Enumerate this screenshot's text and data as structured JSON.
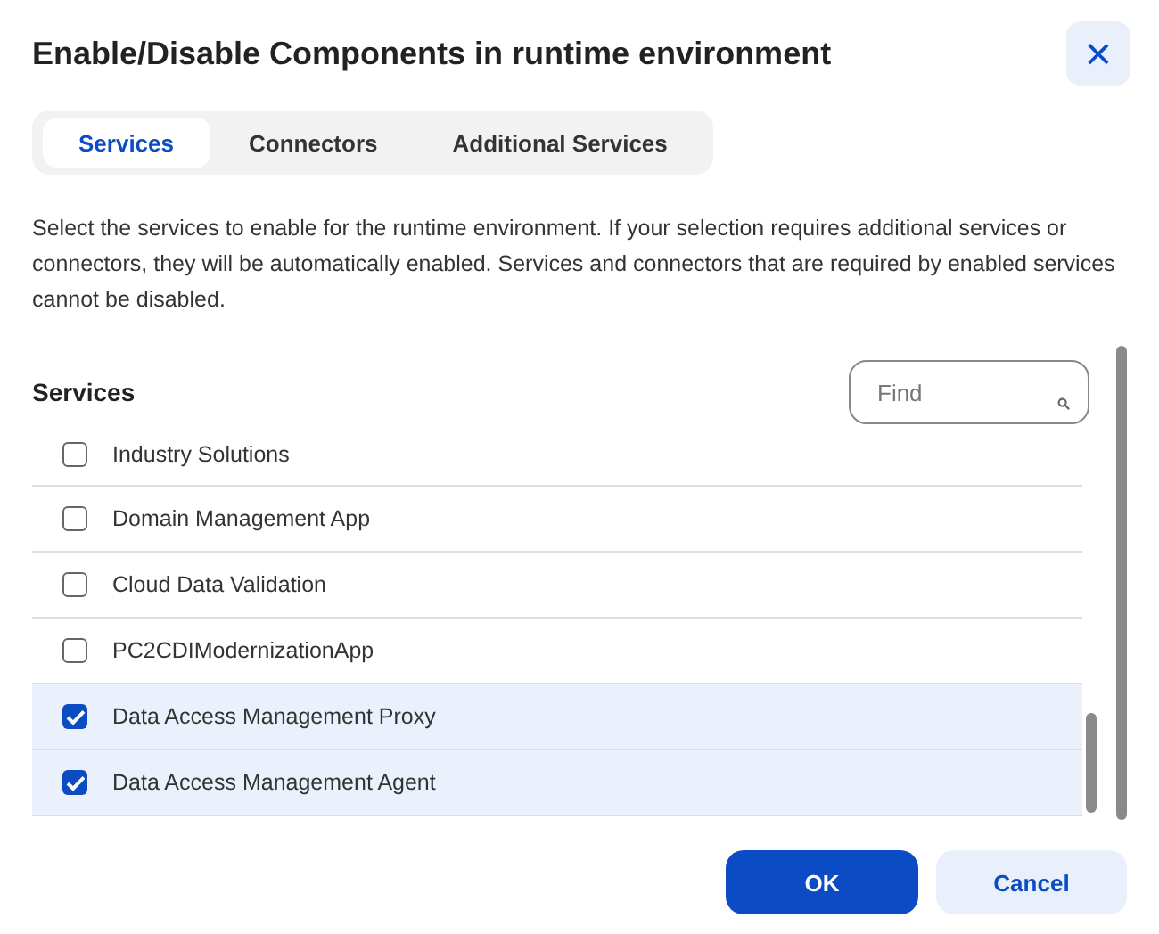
{
  "dialog": {
    "title": "Enable/Disable Components in runtime environment",
    "close_icon": "×"
  },
  "tabs": [
    {
      "label": "Services",
      "selected": true
    },
    {
      "label": "Connectors",
      "selected": false
    },
    {
      "label": "Additional Services",
      "selected": false
    }
  ],
  "description": "Select the services to enable for the runtime environment. If your selection requires additional services or connectors, they will be automatically enabled. Services and connectors that are required by enabled services cannot be disabled.",
  "section": {
    "title": "Services",
    "search": {
      "placeholder": "Find"
    }
  },
  "services": [
    {
      "name": "Industry Solutions",
      "checked": false
    },
    {
      "name": "Domain Management App",
      "checked": false
    },
    {
      "name": "Cloud Data Validation",
      "checked": false
    },
    {
      "name": "PC2CDIModernizationApp",
      "checked": false
    },
    {
      "name": "Data Access Management Proxy",
      "checked": true
    },
    {
      "name": "Data Access Management Agent",
      "checked": true
    }
  ],
  "buttons": [
    {
      "label": "OK",
      "kind": "primary"
    },
    {
      "label": "Cancel",
      "kind": "secondary"
    }
  ]
}
